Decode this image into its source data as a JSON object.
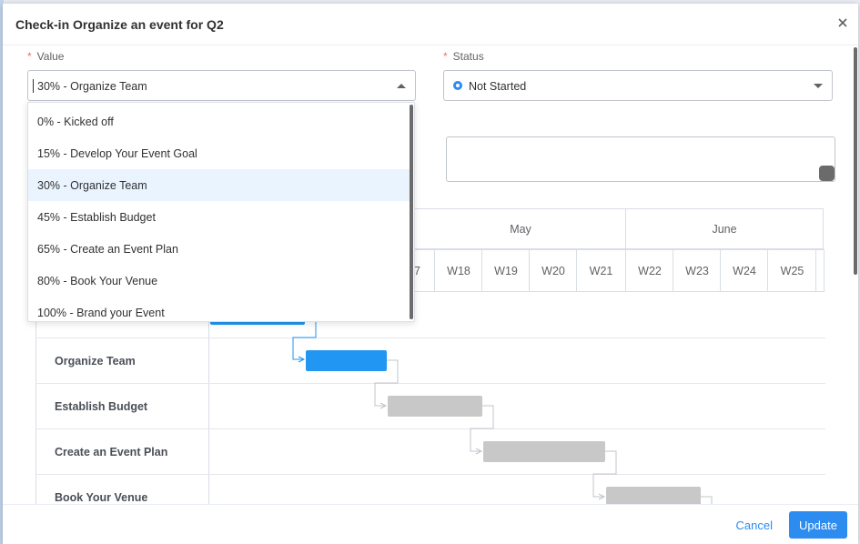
{
  "dialog": {
    "title": "Check-in Organize an event for Q2",
    "close_icon": "close-icon"
  },
  "value_field": {
    "label": "Value",
    "selected": "30% - Organize Team",
    "options": [
      "0% - Kicked off",
      "15% - Develop Your Event Goal",
      "30% - Organize Team",
      "45% - Establish Budget",
      "65% - Create an Event Plan",
      "80% - Book Your Venue",
      "100% - Brand your Event"
    ]
  },
  "status_field": {
    "label": "Status",
    "selected": "Not Started"
  },
  "gantt": {
    "months": [
      "May",
      "June"
    ],
    "weeks": [
      "7",
      "W18",
      "W19",
      "W20",
      "W21",
      "W22",
      "W23",
      "W24",
      "W25"
    ],
    "tasks": [
      {
        "label": "Organize Team",
        "state": "active"
      },
      {
        "label": "Establish Budget",
        "state": "pending"
      },
      {
        "label": "Create an Event Plan",
        "state": "pending"
      },
      {
        "label": "Book Your Venue",
        "state": "pending"
      }
    ],
    "colors": {
      "active": "#2196f3",
      "pending": "#c8c8c8"
    }
  },
  "footer": {
    "cancel_label": "Cancel",
    "update_label": "Update"
  },
  "colors": {
    "accent": "#2d8cf0",
    "required": "#f56c6c"
  }
}
